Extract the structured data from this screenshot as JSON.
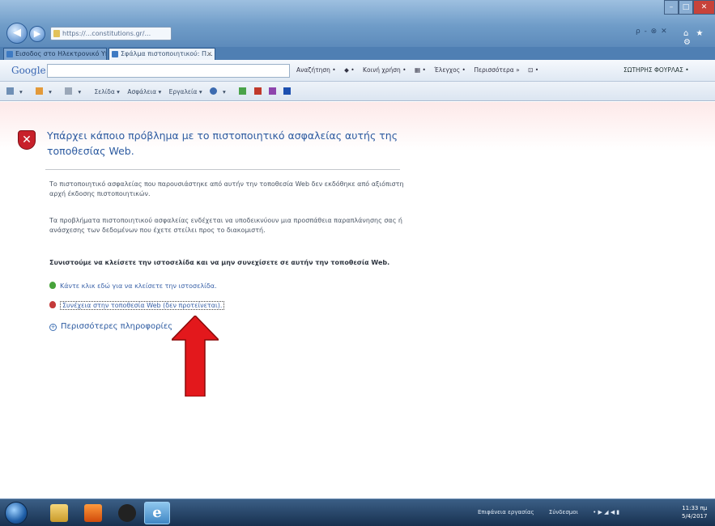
{
  "browser": {
    "address": "https://...constitutions.gr/...",
    "search_controls": "ρ - ⊗ ✕",
    "window_buttons": {
      "minimize": "–",
      "maximize": "□",
      "close": "✕"
    },
    "right_icons": "⌂ ★ ⚙",
    "back_label": "◀",
    "forward_label": "▶"
  },
  "tabs": [
    {
      "label": "Εισοδος στο Ηλεκτρονικό Υπ...",
      "close": ""
    },
    {
      "label": "Σφάλμα πιστοποιητικού: Π...",
      "close": "×"
    }
  ],
  "google_toolbar": {
    "logo": "Google",
    "items": [
      "Αναζήτηση •",
      "◆ •",
      "Κοινή χρήση •",
      "▦ •",
      "Έλεγχος •",
      "Περισσότερα »",
      "⊡ •"
    ],
    "user": "ΣΩΤΗΡΗΣ ΦΟΥΡΛΑΣ •"
  },
  "command_bar": {
    "items": [
      "▾",
      "▾",
      "▾",
      "Σελίδα ▾",
      "Ασφάλεια ▾",
      "Εργαλεία ▾",
      "▾"
    ]
  },
  "page": {
    "heading": "Υπάρχει κάποιο πρόβλημα με το πιστοποιητικό ασφαλείας αυτής της τοποθεσίας Web.",
    "paragraph1": "Το πιστοποιητικό ασφαλείας που παρουσιάστηκε από αυτήν την τοποθεσία Web δεν εκδόθηκε από αξιόπιστη αρχή έκδοσης πιστοποιητικών.",
    "paragraph2": "Τα προβλήματα πιστοποιητικού ασφαλείας ενδέχεται να υποδεικνύουν μια προσπάθεια παραπλάνησης σας ή ανάσχεσης των δεδομένων που έχετε στείλει προς το διακομιστή.",
    "warning": "Συνιστούμε να κλείσετε την ιστοσελίδα και να μην συνεχίσετε σε αυτήν την τοποθεσία Web.",
    "close_link": "Κάντε κλικ εδώ για να κλείσετε την ιστοσελίδα.",
    "continue_link": "Συνέχεια στην τοποθεσία Web (δεν προτείνεται).",
    "more_info": "Περισσότερες πληροφορίες"
  },
  "taskbar": {
    "ie_glyph": "e",
    "tray": [
      "Επιφάνεια εργασίας",
      "Σύνδεσμοι"
    ],
    "tray_icons": "• ▶ ◢ ◀ ▮",
    "time": "11:33 πμ",
    "date": "5/4/2017"
  },
  "colors": {
    "arrow": "#e3181c",
    "link": "#3a62a8",
    "heading": "#2c5aa0"
  }
}
